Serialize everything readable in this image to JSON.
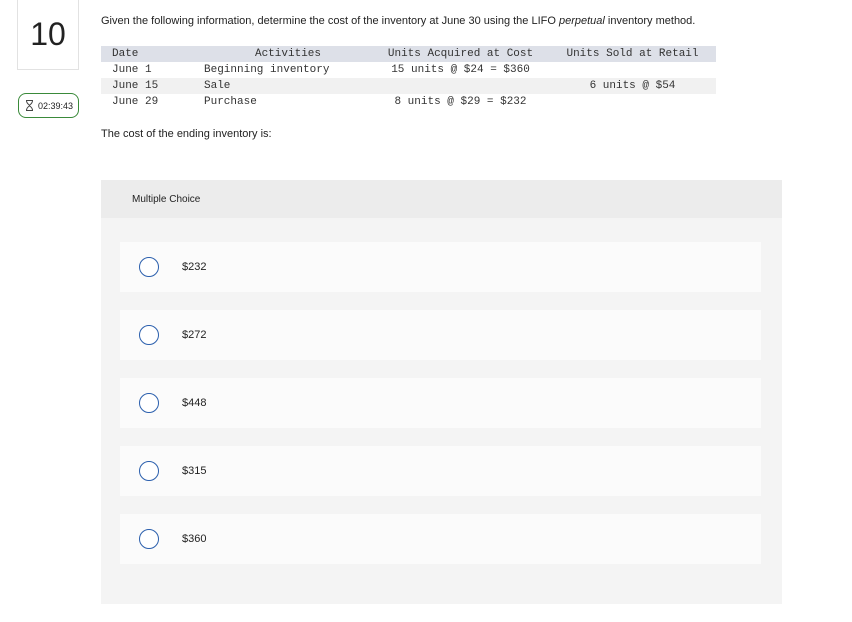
{
  "question": {
    "number": "10",
    "timer": "02:39:43",
    "prompt_before": "Given the following information, determine the cost of the inventory at June 30 using the LIFO ",
    "prompt_emphasis": "perpetual",
    "prompt_after": " inventory method.",
    "ending_text": "The cost of the ending inventory is:"
  },
  "table": {
    "headers": [
      "Date",
      "Activities",
      "Units Acquired at Cost",
      "Units Sold at Retail"
    ],
    "rows": [
      [
        "June 1",
        "Beginning inventory",
        "15 units @ $24 = $360",
        ""
      ],
      [
        "June 15",
        "Sale",
        "",
        "6 units @ $54"
      ],
      [
        "June 29",
        "Purchase",
        "8 units @ $29 = $232",
        ""
      ]
    ]
  },
  "multiple_choice": {
    "title": "Multiple Choice",
    "options": [
      "$232",
      "$272",
      "$448",
      "$315",
      "$360"
    ]
  },
  "colors": {
    "timer_border": "#3a8a3a",
    "radio_border": "#2b5fad",
    "table_header_bg": "#dde0e8"
  }
}
